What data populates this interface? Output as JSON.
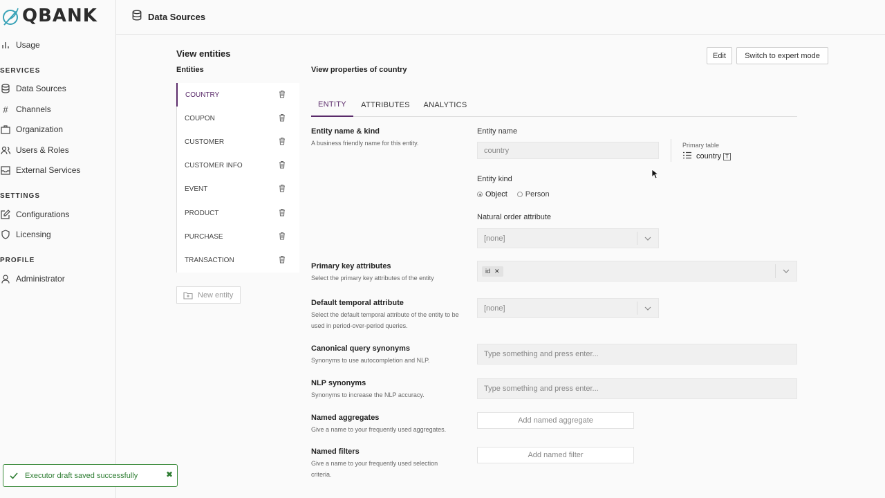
{
  "logo": {
    "text": "QBANK"
  },
  "nav": {
    "usage": "Usage",
    "services_heading": "SERVICES",
    "data_sources": "Data Sources",
    "channels": "Channels",
    "organization": "Organization",
    "users_roles": "Users & Roles",
    "external_services": "External Services",
    "settings_heading": "SETTINGS",
    "configurations": "Configurations",
    "licensing": "Licensing",
    "profile_heading": "PROFILE",
    "administrator": "Administrator"
  },
  "header": {
    "title": "Data Sources"
  },
  "view": {
    "title": "View entities",
    "entities_label": "Entities",
    "props_title": "View properties of country"
  },
  "entities": [
    "COUNTRY",
    "COUPON",
    "CUSTOMER",
    "CUSTOMER INFO",
    "EVENT",
    "PRODUCT",
    "PURCHASE",
    "TRANSACTION"
  ],
  "new_entity_label": "New entity",
  "actions": {
    "edit": "Edit",
    "expert": "Switch to expert mode"
  },
  "tabs": [
    "ENTITY",
    "ATTRIBUTES",
    "ANALYTICS"
  ],
  "form": {
    "name_kind": {
      "title": "Entity name & kind",
      "desc": "A business friendly name for this entity."
    },
    "entity_name_label": "Entity name",
    "entity_name_value": "country",
    "primary_table_label": "Primary table",
    "primary_table_value": "country",
    "entity_kind_label": "Entity kind",
    "kind_object": "Object",
    "kind_person": "Person",
    "natural_order_label": "Natural order attribute",
    "natural_order_value": "[none]",
    "pk": {
      "title": "Primary key attributes",
      "desc": "Select the primary key attributes of the entity",
      "chip": "id"
    },
    "temporal": {
      "title": "Default temporal attribute",
      "desc": "Select the default temporal attribute of the entity to be used in period-over-period queries.",
      "value": "[none]"
    },
    "canonical": {
      "title": "Canonical query synonyms",
      "desc": "Synonyms to use autocompletion and NLP.",
      "placeholder": "Type something and press enter..."
    },
    "nlp": {
      "title": "NLP synonyms",
      "desc": "Synonyms to increase the NLP accuracy.",
      "placeholder": "Type something and press enter..."
    },
    "aggregates": {
      "title": "Named aggregates",
      "desc": "Give a name to your frequently used aggregates.",
      "button": "Add named aggregate"
    },
    "filters": {
      "title": "Named filters",
      "desc": "Give a name to your frequently used selection criteria.",
      "button": "Add named filter"
    }
  },
  "toast": {
    "message": "Executor draft saved successfully"
  },
  "colors": {
    "accent": "#5a2a6a",
    "success": "#2e7d32",
    "logo_icon": "#3aa3b8"
  }
}
